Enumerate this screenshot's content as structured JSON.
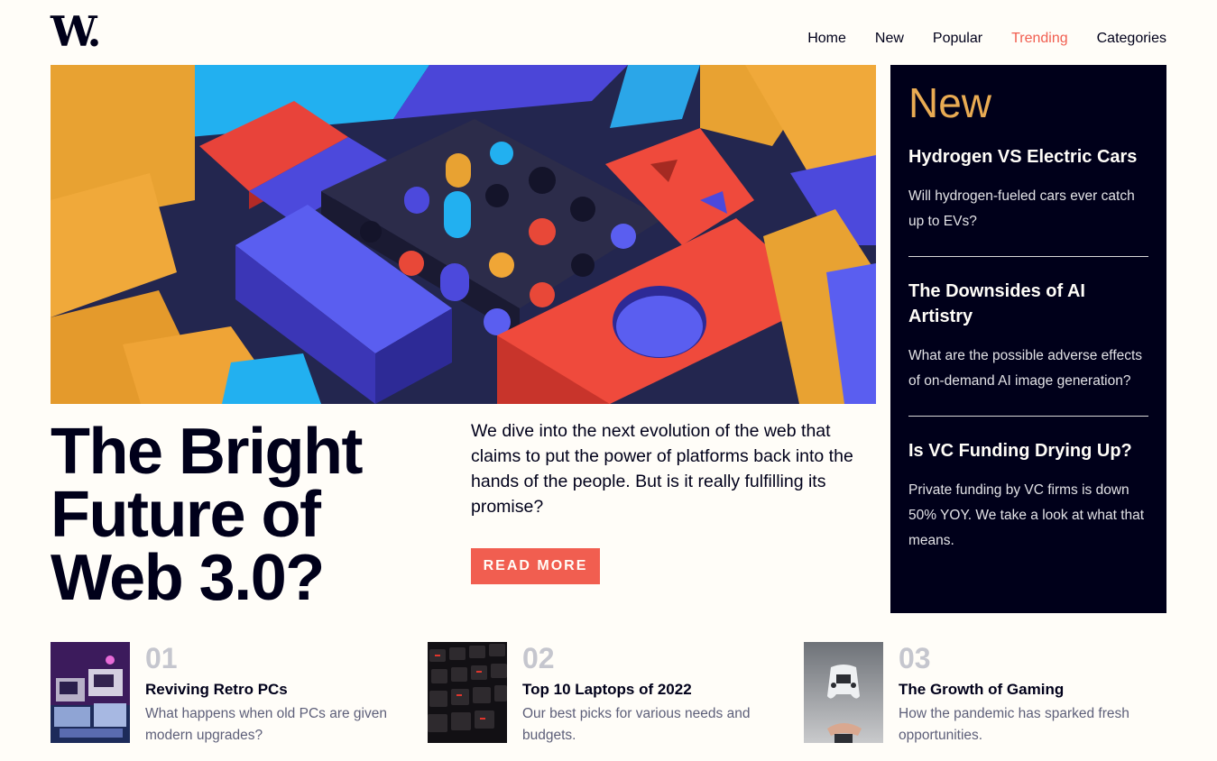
{
  "header": {
    "logo": "W.",
    "nav": [
      "Home",
      "New",
      "Popular",
      "Trending",
      "Categories"
    ],
    "active_nav": "Trending"
  },
  "hero": {
    "title": "The Bright Future of Web 3.0?",
    "title_lines": [
      "The Bright",
      "Future of",
      "Web 3.0?"
    ],
    "description": "We dive into the next evolution of the web that claims to put the power of platforms back into the hands of the people. But is it really fulfilling its promise?",
    "cta": "READ MORE"
  },
  "new_panel": {
    "heading": "New",
    "items": [
      {
        "title": "Hydrogen VS Electric Cars",
        "desc": "Will hydrogen-fueled cars ever catch up to EVs?"
      },
      {
        "title": "The Downsides of AI Artistry",
        "desc": "What are the possible adverse effects of on-demand AI image generation?"
      },
      {
        "title": "Is VC Funding Drying Up?",
        "desc": "Private funding by VC firms is down 50% YOY. We take a look at what that means."
      }
    ]
  },
  "bottom": [
    {
      "num": "01",
      "title": "Reviving Retro PCs",
      "desc": "What happens when old PCs are given modern upgrades?"
    },
    {
      "num": "02",
      "title": "Top 10 Laptops of 2022",
      "desc": "Our best picks for various needs and budgets."
    },
    {
      "num": "03",
      "title": "The Growth of Gaming",
      "desc": "How the pandemic has sparked fresh opportunities."
    }
  ],
  "colors": {
    "background": "#fffdf8",
    "dark": "#00001a",
    "accent_red": "#f15e50",
    "accent_orange": "#e9ab53",
    "muted": "#5d5f79"
  }
}
